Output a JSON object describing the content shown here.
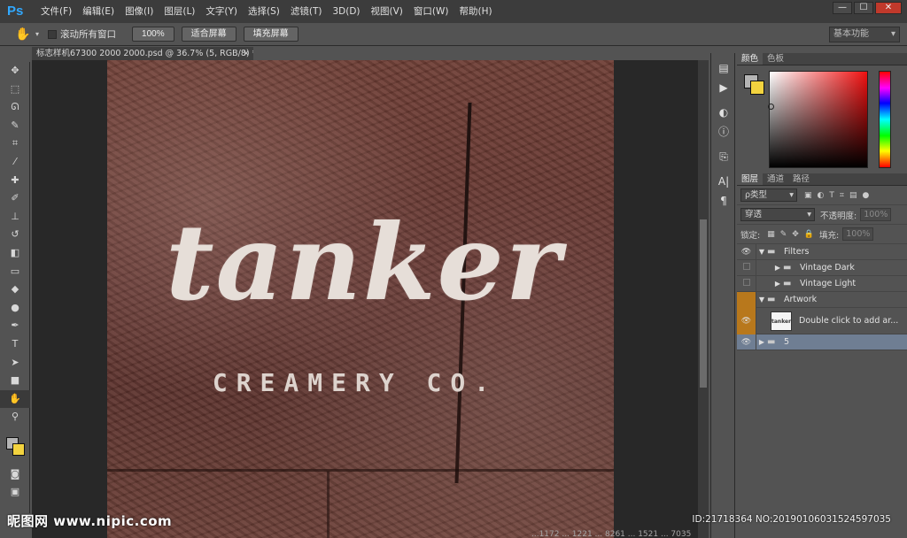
{
  "app": {
    "logo": "Ps"
  },
  "menu": [
    "文件(F)",
    "编辑(E)",
    "图像(I)",
    "图层(L)",
    "文字(Y)",
    "选择(S)",
    "滤镜(T)",
    "3D(D)",
    "视图(V)",
    "窗口(W)",
    "帮助(H)"
  ],
  "window_controls": {
    "minimize": "—",
    "maximize": "☐",
    "close": "✕"
  },
  "options": {
    "scroll_all_label": "滚动所有窗口",
    "btn_100": "100%",
    "btn_fit": "适合屏幕",
    "btn_fill": "填充屏幕",
    "workspace": "基本功能"
  },
  "document": {
    "tab_title": "标志样机67300 2000 2000.psd @ 36.7% (5, RGB/8) *",
    "tab_close": "×",
    "logo_main": "tanker",
    "logo_sub": "CREAMERY CO."
  },
  "color_panel": {
    "tabs": [
      "颜色",
      "色板"
    ]
  },
  "layers_panel": {
    "tabs": [
      "图层",
      "通道",
      "路径"
    ],
    "filter_kind": "ρ类型",
    "blend_mode": "穿透",
    "opacity_label": "不透明度:",
    "opacity_value": "100%",
    "lock_label": "锁定:",
    "fill_label": "填充:",
    "fill_value": "100%",
    "layers": [
      {
        "name": "Filters"
      },
      {
        "name": "Vintage Dark"
      },
      {
        "name": "Vintage Light"
      },
      {
        "name": "Artwork"
      },
      {
        "name": "Double click to add ar...",
        "thumb_text": "tanker"
      },
      {
        "name": "5"
      }
    ]
  },
  "watermark": {
    "site": "昵图网 www.nipic.com",
    "id_text": "ID:21718364 NO:20190106031524597035",
    "bottom_text": "...1172 ... 1221 ... 8261 ... 1521 ... 7035"
  },
  "colors": {
    "foreground": "#b5b5b5",
    "background": "#f3d33f",
    "ps_blue": "#31a8ff",
    "selected_layer": "#6f7e93",
    "highlight_orange": "#b8781c"
  }
}
